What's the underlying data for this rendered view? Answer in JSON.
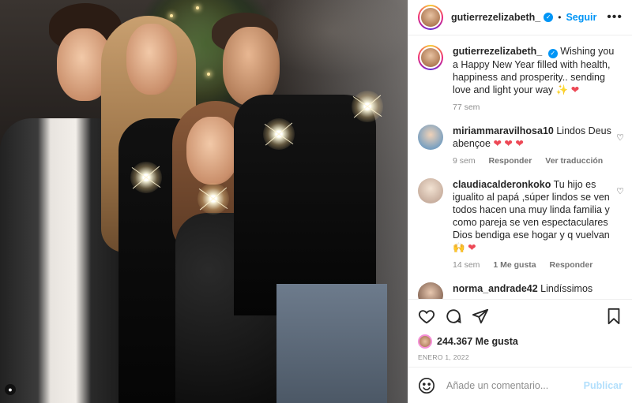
{
  "post": {
    "username": "gutierrezelizabeth_",
    "follow_label": "Seguir",
    "more_label": "•••",
    "separator": "•"
  },
  "caption": {
    "username": "gutierrezelizabeth_",
    "text": "Wishing you a Happy New Year filled with health, happiness and prosperity.. sending love and light your way",
    "emoji_sparkle": "✨",
    "emoji_heart": "❤",
    "time": "77 sem"
  },
  "comments": [
    {
      "username": "miriammaravilhosa10",
      "text": "Lindos Deus abençoe",
      "emojis": "❤ ❤ ❤",
      "time": "9 sem",
      "reply": "Responder",
      "translate": "Ver traducción"
    },
    {
      "username": "claudiacalderonkoko",
      "text": "Tu hijo es igualito al papá ,súper lindos se ven todos hacen una muy linda familia y como pareja se ven espectaculares Dios bendiga ese hogar y q vuelvan",
      "emoji_hands": "🙌",
      "emoji_heart": "❤",
      "time": "14 sem",
      "likes": "1 Me gusta",
      "reply": "Responder"
    },
    {
      "username": "norma_andrade42",
      "text": "Lindíssimos"
    }
  ],
  "engagement": {
    "likes_count": "244.367",
    "likes_label": "Me gusta",
    "date": "ENERO 1, 2022"
  },
  "add_comment": {
    "placeholder": "Añade un comentario...",
    "post_label": "Publicar"
  },
  "icons": {
    "like": "heart-icon",
    "comment": "comment-icon",
    "share": "share-icon",
    "save": "bookmark-icon",
    "emoji": "emoji-icon",
    "tag": "user-tag-icon",
    "verified": "verified-badge-icon"
  },
  "colors": {
    "accent": "#0095f6",
    "heart": "#ed4956",
    "muted": "#8e8e8e"
  }
}
